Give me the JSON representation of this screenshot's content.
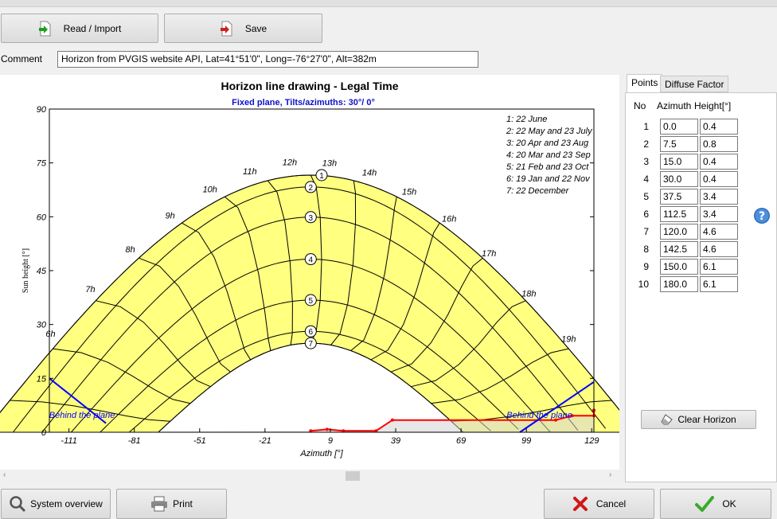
{
  "toolbar": {
    "read_label": "Read / Import",
    "save_label": "Save"
  },
  "comment": {
    "label": "Comment",
    "value": "Horizon from PVGIS website API, Lat=41°51'0\", Long=-76°27'0\", Alt=382m"
  },
  "chart_data": {
    "type": "line",
    "title": "Horizon line drawing - Legal Time",
    "subtitle": "Fixed plane, Tilts/azimuths: 30°/ 0°",
    "xlabel": "Azimuth [°]",
    "ylabel": "Sun height [°]",
    "xlim": [
      -120,
      130
    ],
    "ylim": [
      0,
      90
    ],
    "xticks": [
      "-111",
      "-81",
      "-51",
      "-21",
      "9",
      "39",
      "69",
      "99",
      "129"
    ],
    "yticks": [
      "0",
      "15",
      "30",
      "45",
      "60",
      "75",
      "90"
    ],
    "legend": [
      "1: 22 June",
      "2: 22 May and 23 July",
      "3: 20 Apr and 23 Aug",
      "4: 20 Mar and 23 Sep",
      "5: 21 Feb and 23 Oct",
      "6: 19 Jan and 22 Nov",
      "7: 22 December"
    ],
    "hour_labels": [
      "6h",
      "7h",
      "8h",
      "9h",
      "10h",
      "11h",
      "12h",
      "13h",
      "14h",
      "15h",
      "16h",
      "17h",
      "18h",
      "19h"
    ],
    "behind_label": "Behind the plane",
    "sun_paths": [
      {
        "name": "1",
        "max": 71.6
      },
      {
        "name": "2",
        "max": 68.3
      },
      {
        "name": "3",
        "max": 59.9
      },
      {
        "name": "4",
        "max": 48.2
      },
      {
        "name": "5",
        "max": 36.8
      },
      {
        "name": "6",
        "max": 28.1
      },
      {
        "name": "7",
        "max": 24.8
      }
    ],
    "horizon": {
      "azimuth": [
        0,
        7.5,
        15,
        30,
        37.5,
        112.5,
        120,
        142.5,
        150,
        180
      ],
      "height": [
        0.4,
        0.8,
        0.4,
        0.4,
        3.4,
        3.4,
        4.6,
        4.6,
        6.1,
        6.1
      ]
    },
    "colors": {
      "sun_area": "#ffff80",
      "horizon": "#ff0000",
      "plane": "#0000ff",
      "shade": "#d3d3d3"
    }
  },
  "tabs": {
    "points": "Points",
    "diffuse": "Diffuse Factor"
  },
  "table": {
    "headers": {
      "no": "No",
      "azimuth": "Azimuth",
      "height": "Height[°]"
    },
    "rows": [
      {
        "no": "1",
        "azimuth": "0.0",
        "height": "0.4"
      },
      {
        "no": "2",
        "azimuth": "7.5",
        "height": "0.8"
      },
      {
        "no": "3",
        "azimuth": "15.0",
        "height": "0.4"
      },
      {
        "no": "4",
        "azimuth": "30.0",
        "height": "0.4"
      },
      {
        "no": "5",
        "azimuth": "37.5",
        "height": "3.4"
      },
      {
        "no": "6",
        "azimuth": "112.5",
        "height": "3.4"
      },
      {
        "no": "7",
        "azimuth": "120.0",
        "height": "4.6"
      },
      {
        "no": "8",
        "azimuth": "142.5",
        "height": "4.6"
      },
      {
        "no": "9",
        "azimuth": "150.0",
        "height": "6.1"
      },
      {
        "no": "10",
        "azimuth": "180.0",
        "height": "6.1"
      }
    ]
  },
  "clear_label": "Clear Horizon",
  "bottom": {
    "system_overview": "System overview",
    "print": "Print",
    "cancel": "Cancel",
    "ok": "OK"
  },
  "icons": [
    "read-icon",
    "save-icon",
    "help-icon",
    "eraser-icon",
    "magnifier-icon",
    "printer-icon",
    "cancel-icon",
    "ok-icon"
  ]
}
